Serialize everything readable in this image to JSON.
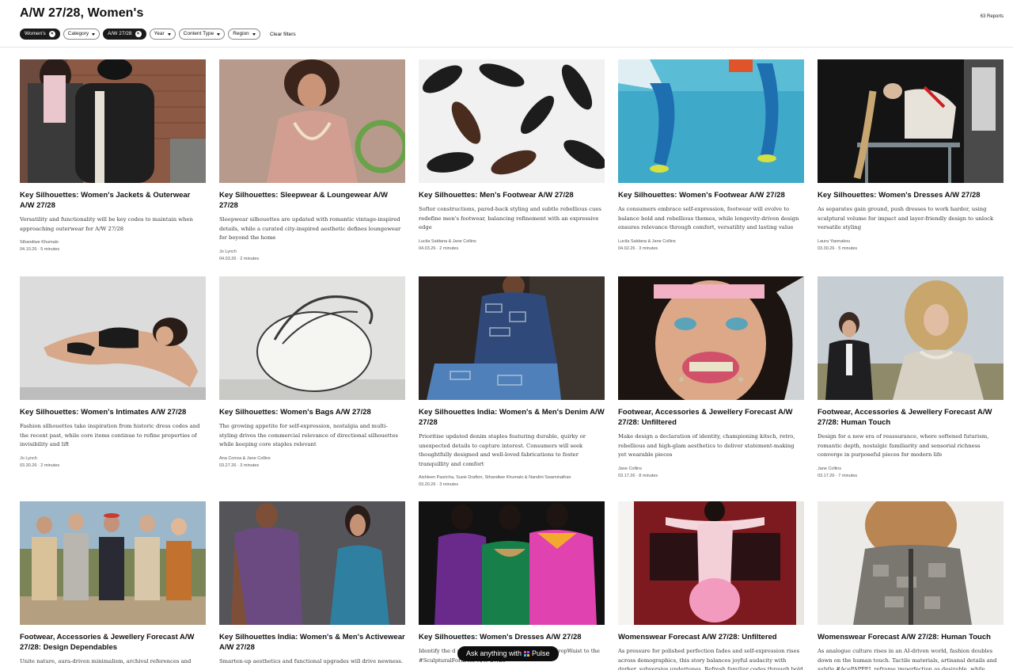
{
  "header": {
    "title": "A/W 27/28, Women's",
    "report_count": "63 Reports"
  },
  "filters": {
    "chips": [
      {
        "label": "Women's",
        "active": true
      },
      {
        "label": "Category",
        "active": false
      },
      {
        "label": "A/W 27/28",
        "active": true
      },
      {
        "label": "Year",
        "active": false
      },
      {
        "label": "Content Type",
        "active": false
      },
      {
        "label": "Region",
        "active": false
      }
    ],
    "clear_label": "Clear filters"
  },
  "cards": [
    {
      "title": "Key Silhouettes: Women's Jackets & Outerwear A/W 27/28",
      "desc": "Versatility and functionality will be key codes to maintain when approaching outerwear for A/W 27/28",
      "author": "Sthandiwe Khumalo",
      "meta": "04.10.26 · 5 minutes"
    },
    {
      "title": "Key Silhouettes: Sleepwear & Loungewear A/W 27/28",
      "desc": "Sleepwear silhouettes are updated with romantic vintage-inspired details, while a curated city-inspired aesthetic defines loungewear for beyond the home",
      "author": "Jo Lynch",
      "meta": "04.03.26 · 2 minutes"
    },
    {
      "title": "Key Silhouettes: Men's Footwear A/W 27/28",
      "desc": "Softer constructions, pared-back styling and subtle rebellious cues redefine men's footwear, balancing refinement with an expressive edge",
      "author": "Lucila Saldana & Jane Collins",
      "meta": "04.03.26 · 2 minutes"
    },
    {
      "title": "Key Silhouettes: Women's Footwear A/W 27/28",
      "desc": "As consumers embrace self-expression, footwear will evolve to balance bold and rebellious themes, while longevity-driven design ensures relevance through comfort, versatility and lasting value",
      "author": "Lucila Saldana & Jane Collins",
      "meta": "04.02.26 · 3 minutes"
    },
    {
      "title": "Key Silhouettes: Women's Dresses A/W 27/28",
      "desc": "As separates gain ground, push dresses to work harder, using sculptural volume for impact and layer-friendly design to unlock versatile styling",
      "author": "Laura Yiannakou",
      "meta": "03.30.26 · 5 minutes"
    },
    {
      "title": "Key Silhouettes: Women's Intimates A/W 27/28",
      "desc": "Fashion silhouettes take inspiration from historic dress codes and the recent past, while core items continue to refine properties of invisibility and lift",
      "author": "Jo Lynch",
      "meta": "03.30.26 · 2 minutes"
    },
    {
      "title": "Key Silhouettes: Women's Bags A/W 27/28",
      "desc": "The growing appetite for self-expression, nostalgia and multi-styling drives the commercial relevance of directional silhouettes while keeping core staples relevant",
      "author": "Ana Correa & Jane Collins",
      "meta": "03.27.26 · 3 minutes"
    },
    {
      "title": "Key Silhouettes India: Women's & Men's Denim A/W 27/28",
      "desc": "Prioritise updated denim staples featuring durable, quirky or unexpected details to capture interest. Consumers will seek thoughtfully designed and well-loved fabrications to foster tranquillity and comfort",
      "author": "Aishleen Pasricha, Susie Drafton, Sthandiwe Khumalo & Nandini Swaminathan",
      "meta": "03.20.26 · 3 minutes"
    },
    {
      "title": "Footwear, Accessories & Jewellery Forecast A/W 27/28: Unfiltered",
      "desc": "Make design a declaration of identity, championing kitsch, retro, rebellious and high-glam aesthetics to deliver statement-making yet wearable pieces",
      "author": "Jane Collins",
      "meta": "03.17.26 · 8 minutes"
    },
    {
      "title": "Footwear, Accessories & Jewellery Forecast A/W 27/28: Human Touch",
      "desc": "Design for a new era of reassurance, where softened futurism, romantic depth, nostalgic familiarity and sensorial richness converge in purposeful pieces for modern life",
      "author": "Jane Collins",
      "meta": "03.17.26 · 7 minutes"
    },
    {
      "title": "Footwear, Accessories & Jewellery Forecast A/W 27/28: Design Dependables",
      "desc": "Unite nature, aura-driven minimalism, archival references and",
      "author": "",
      "meta": ""
    },
    {
      "title": "Key Silhouettes India: Women's & Men's Activewear A/W 27/28",
      "desc": "Smarten-up aesthetics and functional upgrades will drive newness.",
      "author": "",
      "meta": ""
    },
    {
      "title": "Key Silhouettes: Women's Dresses A/W 27/28",
      "desc": "Identify the d                                                  nscious consumers, an                                              , from the #DropWaist to the #SculpturalForm for A/W 27/28",
      "author": "",
      "meta": ""
    },
    {
      "title": "Womenswear Forecast A/W 27/28: Unfiltered",
      "desc": "As pressure for polished perfection fades and self-expression rises across demographics, this story balances joyful audacity with darker, subversive undertones. Refresh familiar codes through bold colour",
      "author": "",
      "meta": ""
    },
    {
      "title": "Womenswear Forecast A/W 27/28: Human Touch",
      "desc": "As analogue culture rises in an AI-driven world, fashion doubles down on the human touch. Tactile materials, artisanal details and subtle #AcePAPPEL reframe imperfection as desirable, while",
      "author": "",
      "meta": ""
    }
  ],
  "pulse": {
    "prefix": "Ask anything with",
    "brand": "Pulse"
  },
  "colors": {
    "ink": "#111111",
    "chip_active": "#1a1a1a",
    "divider": "#e6e6e6"
  }
}
